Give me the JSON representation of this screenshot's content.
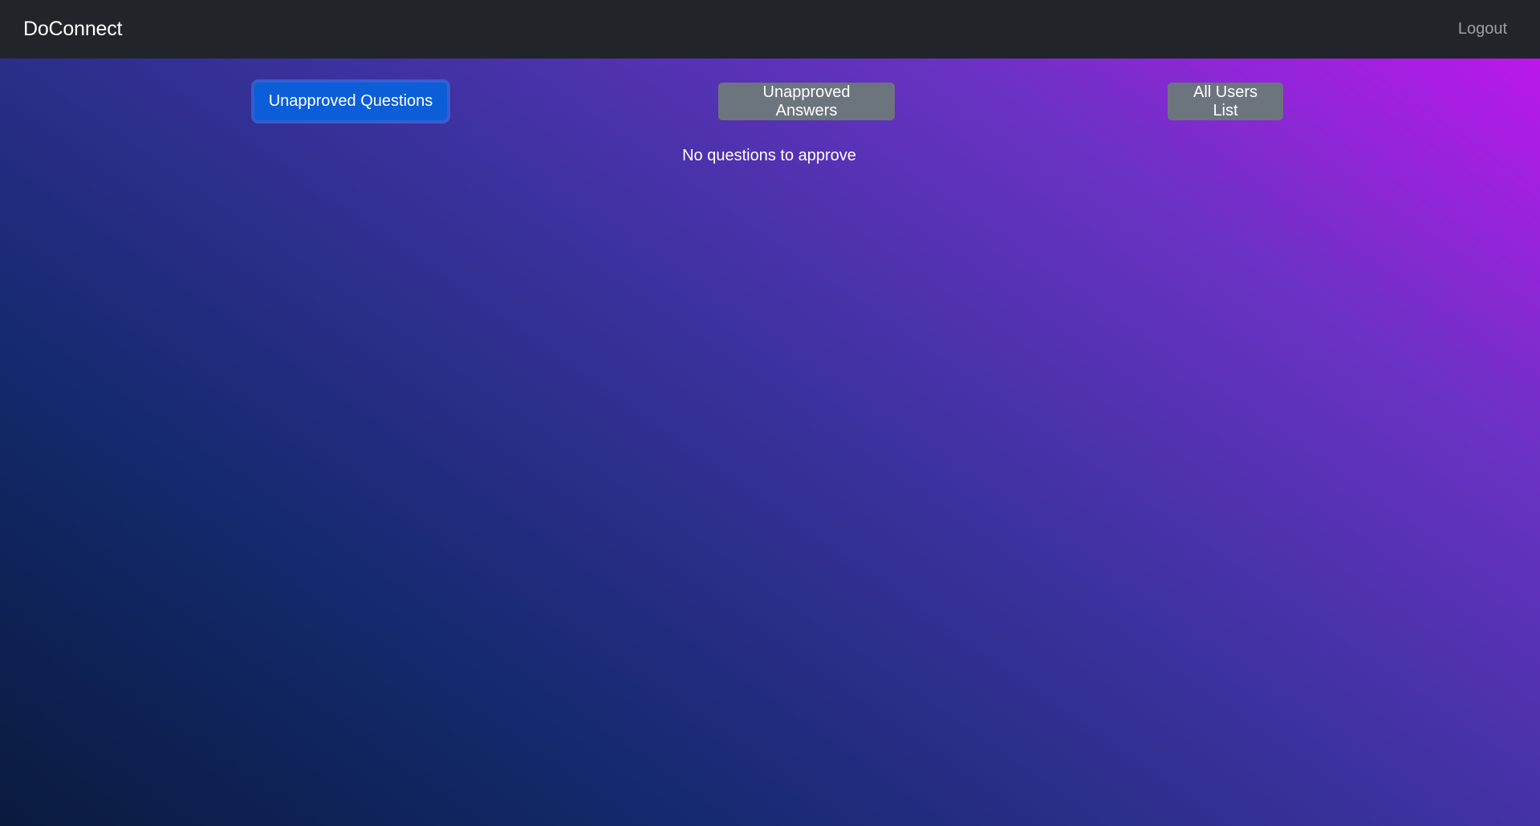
{
  "navbar": {
    "brand": "DoConnect",
    "logout_label": "Logout"
  },
  "tabs": [
    {
      "label": "Unapproved Questions",
      "active": true
    },
    {
      "label": "Unapproved Answers",
      "active": false
    },
    {
      "label": "All Users List",
      "active": false
    }
  ],
  "content": {
    "empty_message": "No questions to approve"
  },
  "colors": {
    "navbar_bg": "#212529",
    "primary": "#0b5ed7",
    "secondary": "#6c757d",
    "gradient_top_right": "#bb18ec",
    "gradient_bottom_left": "#0a1a3e"
  }
}
